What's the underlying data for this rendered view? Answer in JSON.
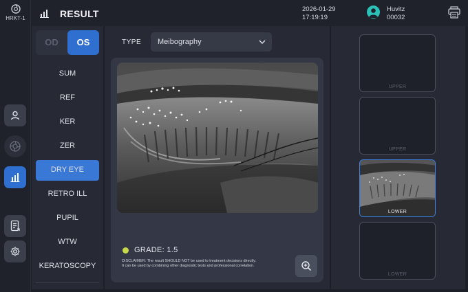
{
  "device": {
    "name": "HRKT-1"
  },
  "header": {
    "title": "RESULT",
    "date": "2026-01-29",
    "time": "17:19:19",
    "user_name": "Huvitz",
    "user_id": "00032"
  },
  "eye": {
    "od_label": "OD",
    "os_label": "OS",
    "selected": "OS"
  },
  "menu": {
    "items": [
      {
        "label": "SUM"
      },
      {
        "label": "REF"
      },
      {
        "label": "KER"
      },
      {
        "label": "ZER"
      },
      {
        "label": "DRY EYE"
      },
      {
        "label": "RETRO ILL"
      },
      {
        "label": "PUPIL"
      },
      {
        "label": "WTW"
      },
      {
        "label": "KERATOSCOPY"
      }
    ],
    "selected": "DRY EYE"
  },
  "type": {
    "label": "TYPE",
    "value": "Meibography"
  },
  "result": {
    "grade": "GRADE: 1.5",
    "grade_color": "#c7d84a",
    "disclaimer_line1": "DISCLAIMER: The result SHOULD NOT be used to treatment decisions directly.",
    "disclaimer_line2": "It can be used by combining other diagnostic tests and professional correlation."
  },
  "thumbnails": [
    {
      "caption": "UPPER",
      "active": false
    },
    {
      "caption": "UPPER",
      "active": false
    },
    {
      "caption": "LOWER",
      "active": true
    },
    {
      "caption": "LOWER",
      "active": false
    }
  ],
  "rail_icons": [
    "user-icon",
    "aperture-icon",
    "chart-icon",
    "report-icon",
    "settings-icon"
  ],
  "colors": {
    "accent": "#2f6fd0",
    "avatar": "#2cc1b8",
    "background": "#1c1f28",
    "panel": "#272a35"
  }
}
